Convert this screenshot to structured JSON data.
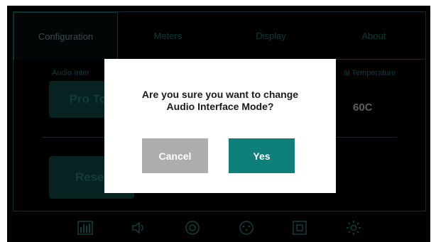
{
  "tabs": [
    {
      "label": "Configuration",
      "active": true
    },
    {
      "label": "Meters",
      "active": false
    },
    {
      "label": "Display",
      "active": false
    },
    {
      "label": "About",
      "active": false
    }
  ],
  "content": {
    "audio_interface_label": "Audio Inter",
    "pro_tools_button": "Pro Too",
    "temperature_label": "al Temperature",
    "temperature_value": "60C",
    "reset_button": "Reset"
  },
  "bottom_icons": [
    "meters-icon",
    "speaker-icon",
    "dial-icon",
    "connector-icon",
    "square-icon",
    "gear-icon"
  ],
  "dialog": {
    "message_line1": "Are you sure you want to change",
    "message_line2": "Audio Interface Mode?",
    "cancel_label": "Cancel",
    "yes_label": "Yes"
  },
  "colors": {
    "accent": "#0e8079",
    "cancel": "#adadad",
    "background": "#000000"
  }
}
